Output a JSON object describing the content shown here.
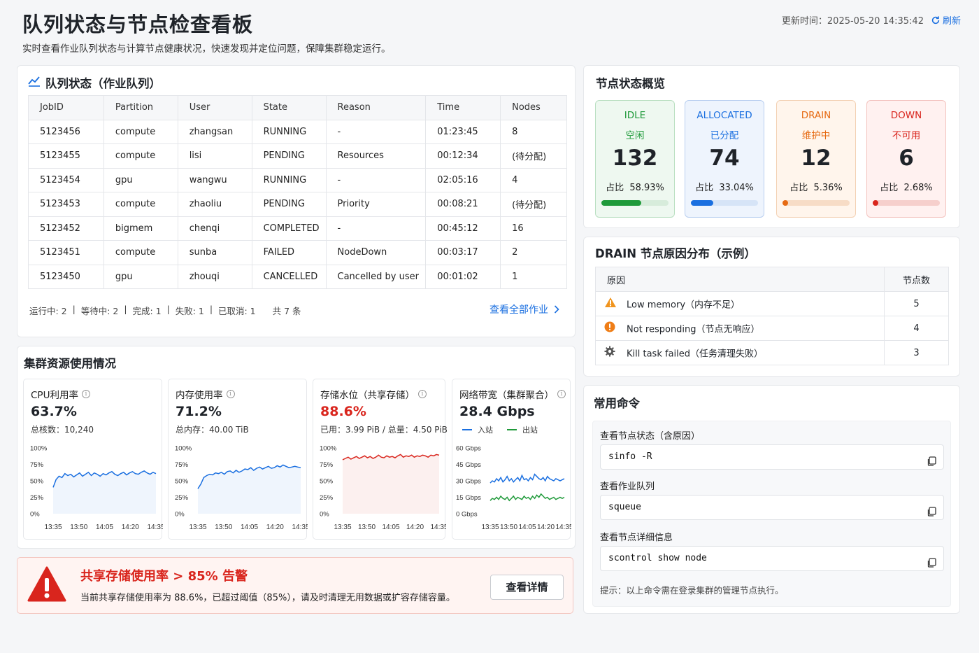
{
  "header": {
    "title": "队列状态与节点检查看板",
    "subtitle": "实时查看作业队列状态与计算节点健康状况，快速发现并定位问题，保障集群稳定运行。",
    "update_label": "更新时间：",
    "update_time": "2025-05-20 14:35:42",
    "refresh_label": "刷新"
  },
  "queue": {
    "title": "队列状态（作业队列）",
    "columns": [
      "JobID",
      "Partition",
      "User",
      "State",
      "Reason",
      "Time",
      "Nodes"
    ],
    "rows": [
      {
        "JobID": "5123456",
        "Partition": "compute",
        "User": "zhangsan",
        "State": "RUNNING",
        "Reason": "-",
        "Time": "01:23:45",
        "Nodes": "8"
      },
      {
        "JobID": "5123455",
        "Partition": "compute",
        "User": "lisi",
        "State": "PENDING",
        "Reason": "Resources",
        "Time": "00:12:34",
        "Nodes": "(待分配)"
      },
      {
        "JobID": "5123454",
        "Partition": "gpu",
        "User": "wangwu",
        "State": "RUNNING",
        "Reason": "-",
        "Time": "02:05:16",
        "Nodes": "4"
      },
      {
        "JobID": "5123453",
        "Partition": "compute",
        "User": "zhaoliu",
        "State": "PENDING",
        "Reason": "Priority",
        "Time": "00:08:21",
        "Nodes": "(待分配)"
      },
      {
        "JobID": "5123452",
        "Partition": "bigmem",
        "User": "chenqi",
        "State": "COMPLETED",
        "Reason": "-",
        "Time": "00:45:12",
        "Nodes": "16"
      },
      {
        "JobID": "5123451",
        "Partition": "compute",
        "User": "sunba",
        "State": "FAILED",
        "Reason": "NodeDown",
        "Time": "00:03:17",
        "Nodes": "2"
      },
      {
        "JobID": "5123450",
        "Partition": "gpu",
        "User": "zhouqi",
        "State": "CANCELLED",
        "Reason": "Cancelled by user",
        "Time": "00:01:02",
        "Nodes": "1"
      }
    ],
    "summary": [
      "运行中: 2",
      "等待中: 2",
      "完成: 1",
      "失败: 1",
      "已取消: 1"
    ],
    "total": "共 7 条",
    "view_all": "查看全部作业"
  },
  "nodes": {
    "title": "节点状态概览",
    "items": [
      {
        "code": "IDLE",
        "label": "空闲",
        "count": "132",
        "ratio": "占比  58.93%",
        "fraction": 0.5893,
        "color": "#1f9a3a",
        "bg": "#eef8f0",
        "border": "#b9dfc1",
        "track": "#d7ecdb"
      },
      {
        "code": "ALLOCATED",
        "label": "已分配",
        "count": "74",
        "ratio": "占比  33.04%",
        "fraction": 0.3304,
        "color": "#1a6fe0",
        "bg": "#eef4fd",
        "border": "#b9cff0",
        "track": "#d6e4f7"
      },
      {
        "code": "DRAIN",
        "label": "维护中",
        "count": "12",
        "ratio": "占比  5.36%",
        "fraction": 0.0536,
        "color": "#e66a12",
        "bg": "#fff5ec",
        "border": "#f3d1b4",
        "track": "#f7dcc6"
      },
      {
        "code": "DOWN",
        "label": "不可用",
        "count": "6",
        "ratio": "占比  2.68%",
        "fraction": 0.0268,
        "color": "#d9251d",
        "bg": "#fff1f0",
        "border": "#f3c3bf",
        "track": "#f6cfcc"
      }
    ]
  },
  "drain": {
    "title": "DRAIN 节点原因分布（示例）",
    "col_reason": "原因",
    "col_count": "节点数",
    "rows": [
      {
        "icon": "warning-icon",
        "reason": "Low memory（内存不足）",
        "count": "5"
      },
      {
        "icon": "alert-circle-icon",
        "reason": "Not responding（节点无响应）",
        "count": "4"
      },
      {
        "icon": "gear-icon",
        "reason": "Kill task failed（任务清理失败）",
        "count": "3"
      }
    ]
  },
  "commands": {
    "title": "常用命令",
    "items": [
      {
        "label": "查看节点状态（含原因）",
        "cmd": "sinfo -R"
      },
      {
        "label": "查看作业队列",
        "cmd": "squeue"
      },
      {
        "label": "查看节点详细信息",
        "cmd": "scontrol show node"
      }
    ],
    "tip": "提示：以上命令需在登录集群的管理节点执行。"
  },
  "resources": {
    "title": "集群资源使用情况",
    "cards": [
      {
        "title": "CPU利用率",
        "value": "63.7%",
        "sub": "总核数：10,240"
      },
      {
        "title": "内存使用率",
        "value": "71.2%",
        "sub": "总内存：40.00 TiB"
      },
      {
        "title": "存储水位（共享存储）",
        "value": "88.6%",
        "sub": "已用：3.99 PiB / 总量：4.50 PiB",
        "value_color": "#d9251d"
      },
      {
        "title": "网络带宽（集群聚合）",
        "value": "28.4 Gbps",
        "legend_in": "入站",
        "legend_out": "出站"
      }
    ]
  },
  "chart_data": [
    {
      "type": "line",
      "x": [
        "13:35",
        "13:50",
        "14:05",
        "14:20",
        "14:35"
      ],
      "ylim": [
        0,
        100
      ],
      "yticks": [
        "100%",
        "75%",
        "50%",
        "25%",
        "0%"
      ],
      "series": [
        {
          "color": "#1a6fe0",
          "values": [
            40,
            52,
            57,
            55,
            61,
            58,
            60,
            56,
            59,
            62,
            57,
            60,
            63,
            58,
            62,
            60,
            57,
            61,
            59,
            62,
            64,
            60,
            58,
            61,
            63,
            59,
            62,
            64,
            61,
            60,
            63,
            65,
            62,
            60,
            63,
            61
          ]
        }
      ]
    },
    {
      "type": "line",
      "x": [
        "13:35",
        "13:50",
        "14:05",
        "14:20",
        "14:35"
      ],
      "ylim": [
        0,
        100
      ],
      "yticks": [
        "100%",
        "75%",
        "50%",
        "25%",
        "0%"
      ],
      "series": [
        {
          "color": "#1a6fe0",
          "values": [
            38,
            45,
            55,
            58,
            60,
            59,
            62,
            61,
            63,
            60,
            64,
            65,
            62,
            66,
            63,
            65,
            68,
            67,
            70,
            66,
            69,
            71,
            68,
            70,
            72,
            69,
            70,
            73,
            71,
            74,
            72,
            70,
            71,
            72,
            71,
            70
          ]
        }
      ]
    },
    {
      "type": "line",
      "x": [
        "13:35",
        "13:50",
        "14:05",
        "14:20",
        "14:35"
      ],
      "ylim": [
        0,
        100
      ],
      "yticks": [
        "100%",
        "75%",
        "50%",
        "25%",
        "0%"
      ],
      "series": [
        {
          "color": "#d9251d",
          "values": [
            82,
            84,
            86,
            83,
            85,
            87,
            84,
            86,
            88,
            85,
            87,
            84,
            86,
            89,
            86,
            85,
            88,
            86,
            87,
            85,
            88,
            90,
            86,
            88,
            87,
            89,
            86,
            88,
            87,
            89,
            88,
            86,
            89,
            88,
            90,
            89
          ]
        }
      ]
    },
    {
      "type": "line",
      "x": [
        "13:35",
        "13:50",
        "14:05",
        "14:20",
        "14:35"
      ],
      "ylim": [
        0,
        60
      ],
      "yticks": [
        "60 Gbps",
        "45 Gbps",
        "30 Gbps",
        "15 Gbps",
        "0 Gbps"
      ],
      "series": [
        {
          "name": "入站",
          "color": "#1a6fe0",
          "values": [
            28,
            30,
            29,
            32,
            30,
            33,
            29,
            31,
            34,
            30,
            32,
            29,
            31,
            33,
            30,
            35,
            31,
            32,
            30,
            33,
            31,
            36,
            34,
            32,
            31,
            33,
            30,
            34,
            32,
            31,
            30,
            32,
            31,
            30,
            31,
            32
          ]
        },
        {
          "name": "出站",
          "color": "#1f9a3a",
          "values": [
            12,
            14,
            13,
            15,
            13,
            16,
            14,
            13,
            15,
            12,
            14,
            16,
            13,
            15,
            14,
            13,
            16,
            14,
            15,
            13,
            16,
            14,
            17,
            15,
            18,
            16,
            14,
            15,
            13,
            14,
            15,
            13,
            14,
            15,
            14,
            15
          ]
        }
      ]
    }
  ],
  "alert": {
    "title": "共享存储使用率 > 85% 告警",
    "text": "当前共享存储使用率为 88.6%，已超过阈值（85%），请及时清理无用数据或扩容存储容量。",
    "button": "查看详情"
  }
}
